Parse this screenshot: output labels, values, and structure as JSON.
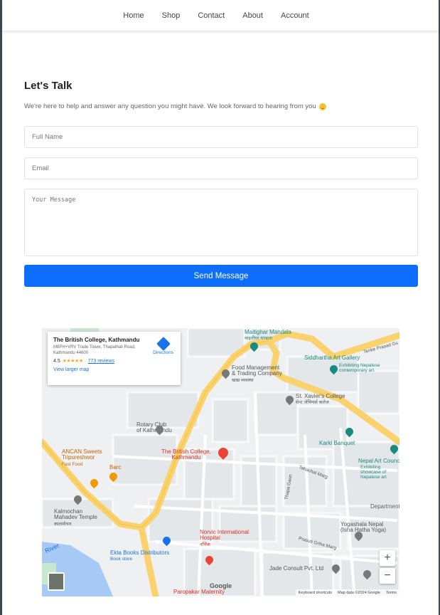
{
  "nav": {
    "items": [
      "Home",
      "Shop",
      "Contact",
      "About",
      "Account"
    ]
  },
  "contact": {
    "title": "Let's Talk",
    "subtitle": "We're here to help and answer any question you might have. We look forward to hearing from you",
    "name_placeholder": "Full Name",
    "email_placeholder": "Email",
    "message_placeholder": "Your Message",
    "send_label": "Send Message",
    "button_color": "#0d6efd"
  },
  "map": {
    "card": {
      "title": "The British College, Kathmandu",
      "address": "M8PH+VRV Trade Tower, Thapathali Road, Kathmandu 44600",
      "rating": "4.5",
      "stars": "★★★★★",
      "reviews": "773 reviews",
      "larger_map": "View larger map",
      "directions": "Directions"
    },
    "labels": {
      "maitighar": "Maitighar Mandala",
      "maitighar_np": "माइतीघर मण्डला",
      "siddhartha": "Siddhartha Art Gallery",
      "siddhartha_sub": "Exhibiting Nepalese contemporary art",
      "food": "Food Management",
      "food2": "& Trading Company",
      "food_np": "खाद्य व्यवस्था",
      "xavier": "St. Xavier's College",
      "xavier_np": "सेन्ट जेभियर्स कलेज",
      "rotary": "Rotary Club",
      "rotary2": "of Kathmandu",
      "karki": "Karki Banquet",
      "nepal_art": "Nepal Art Council",
      "nepal_art_sub": "Exhibiting showcase of Nepalese art",
      "british": "The British College,",
      "british2": "Kathmandu",
      "ancan": "ANCAN Sweets",
      "ancan2": "Tripureshwor",
      "ancan3": "Fast Food",
      "barc": "Barc",
      "kalmochan": "Kalmochan",
      "kalmochan2": "Mahadev Temple",
      "kalmochan_np": "कालमोचन",
      "norvic": "Norvic International",
      "norvic2": "Hospital",
      "norvic_np": "नर्भिक",
      "ekta": "Ekta Books Distributors",
      "ekta_sub": "Book store",
      "jade": "Jade Consult Pvt. Ltd",
      "yogashala": "Yogashala Nepal",
      "yogashala2": "(Isha Hatha Yoga)",
      "depart": "Department",
      "paropakar": "Paropakar Maternity",
      "river": "River",
      "tahachal": "Tahachal Marg",
      "thapa": "Thapa Gaun",
      "prasuti": "Prasuti Griha Marg",
      "teku": "Tenke Prasad Gs",
      "keyboard": "Keyboard shortcuts",
      "mapdata": "Map data ©2024 Google",
      "terms": "Terms",
      "google": "Google",
      "zoom_in": "+",
      "zoom_out": "−"
    },
    "colors": {
      "main_road": "#f9d26e",
      "water": "#a7c9f5",
      "park": "#c7e7cf",
      "block": "#e3e6ea",
      "pin": "#ea4335"
    }
  }
}
